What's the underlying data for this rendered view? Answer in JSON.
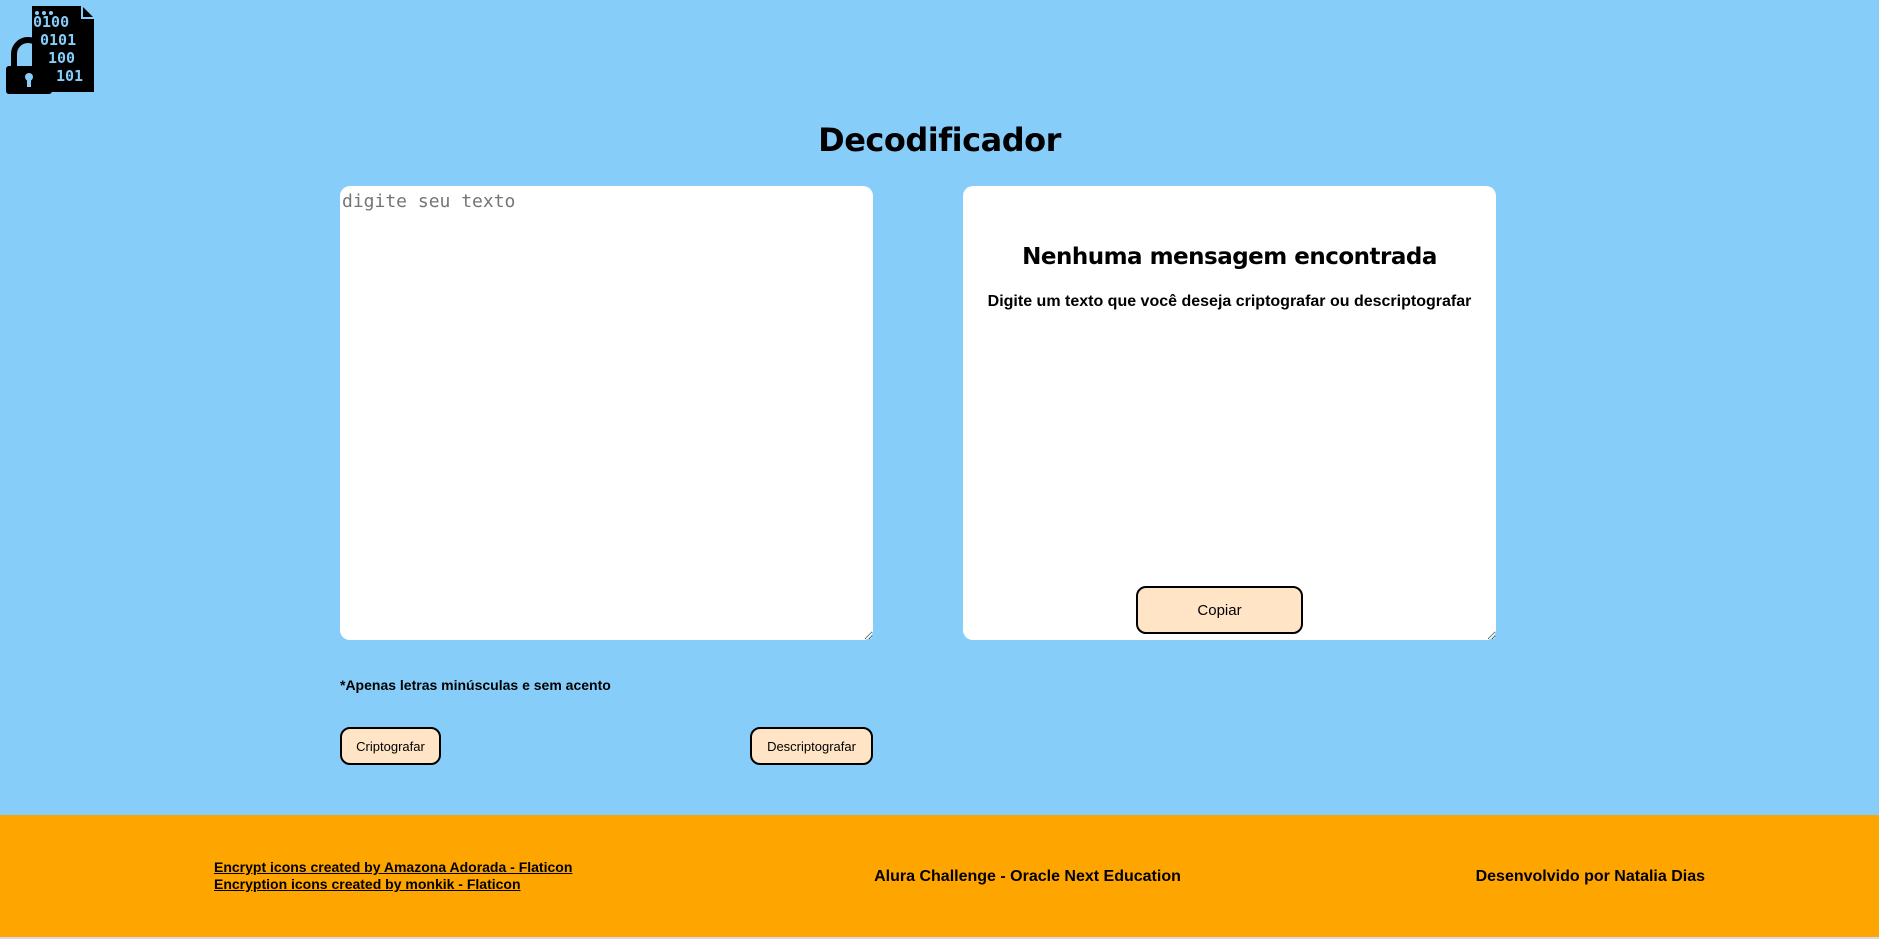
{
  "header": {
    "logo_icon": "encryption-lock-binary-icon",
    "title": "Decodificador"
  },
  "input": {
    "placeholder": "digite seu texto",
    "value": ""
  },
  "output": {
    "title": "Nenhuma mensagem encontrada",
    "subtitle": "Digite um texto que você deseja criptografar ou descriptografar",
    "copy_label": "Copiar"
  },
  "hint": "*Apenas letras minúsculas e sem acento",
  "actions": {
    "encrypt_label": "Criptografar",
    "decrypt_label": "Descriptografar"
  },
  "footer": {
    "credits": [
      "Encrypt icons created by Amazona Adorada - Flaticon",
      "Encryption icons created by monkik - Flaticon"
    ],
    "center_text": "Alura Challenge - Oracle Next Education",
    "right_text": "Desenvolvido por Natalia Dias"
  },
  "colors": {
    "background": "#87cdf9",
    "button": "#ffe4c6",
    "footer": "#ffa500",
    "panel": "#ffffff"
  }
}
